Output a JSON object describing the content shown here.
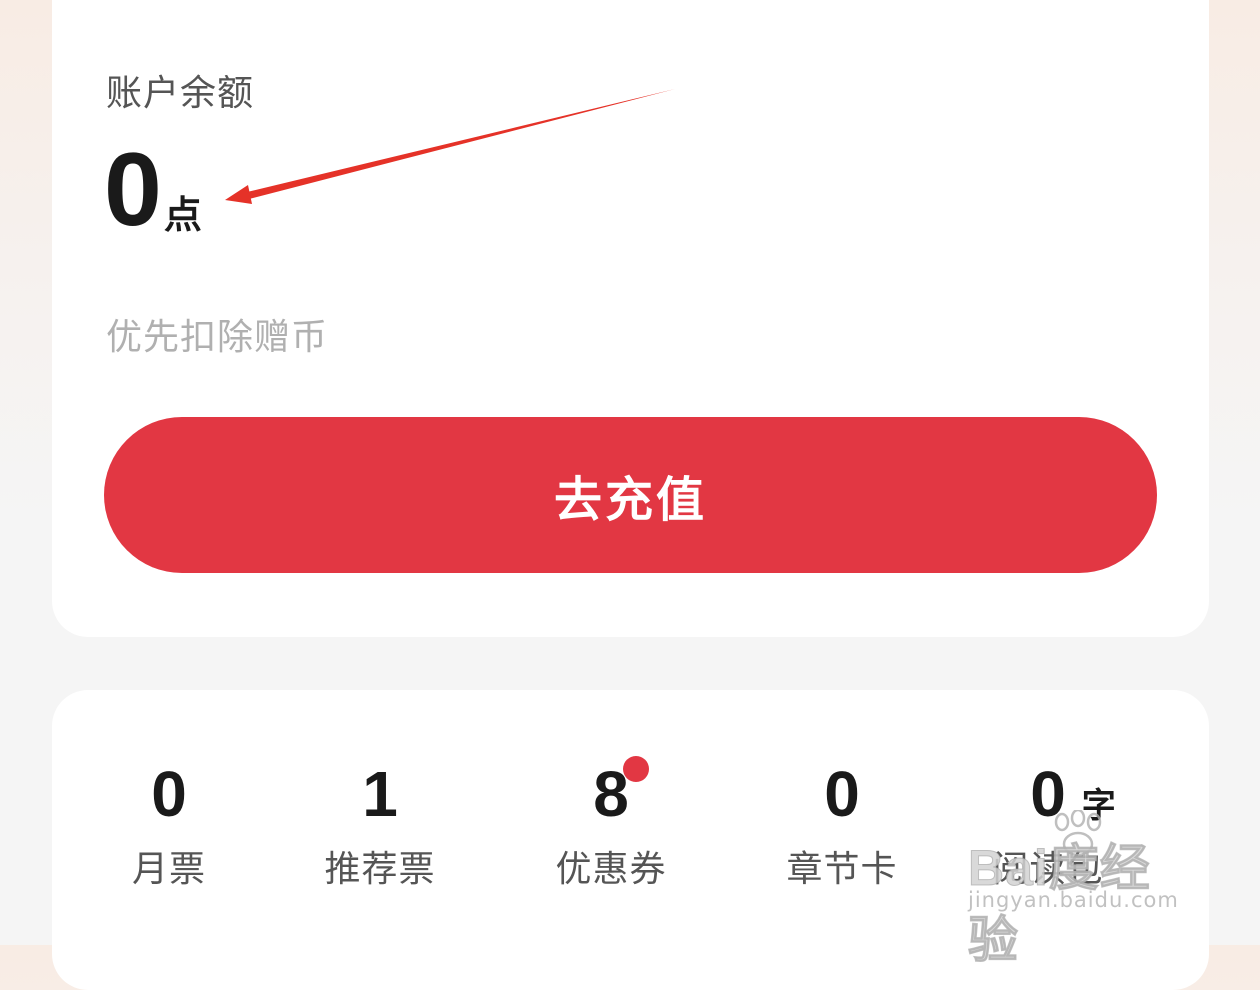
{
  "balance": {
    "label": "账户余额",
    "value": "0",
    "unit": "点",
    "note": "优先扣除赠币"
  },
  "recharge_button": {
    "label": "去充值"
  },
  "assets": {
    "items": [
      {
        "value": "0",
        "label": "月票",
        "unit": "",
        "badge": false
      },
      {
        "value": "1",
        "label": "推荐票",
        "unit": "",
        "badge": false
      },
      {
        "value": "8",
        "label": "优惠券",
        "unit": "",
        "badge": true
      },
      {
        "value": "0",
        "label": "章节卡",
        "unit": "",
        "badge": false
      },
      {
        "value": "0",
        "label": "阅读包",
        "unit": "字",
        "badge": false
      }
    ]
  },
  "colors": {
    "accent": "#e23743",
    "annotation_arrow": "#e53228",
    "text_primary": "#1a1a1a",
    "text_secondary": "#555555",
    "text_muted": "#b0b0b0",
    "card_background": "#ffffff"
  },
  "watermark": {
    "logo_text": "Bai度经验",
    "url": "jingyan.baidu.com"
  }
}
